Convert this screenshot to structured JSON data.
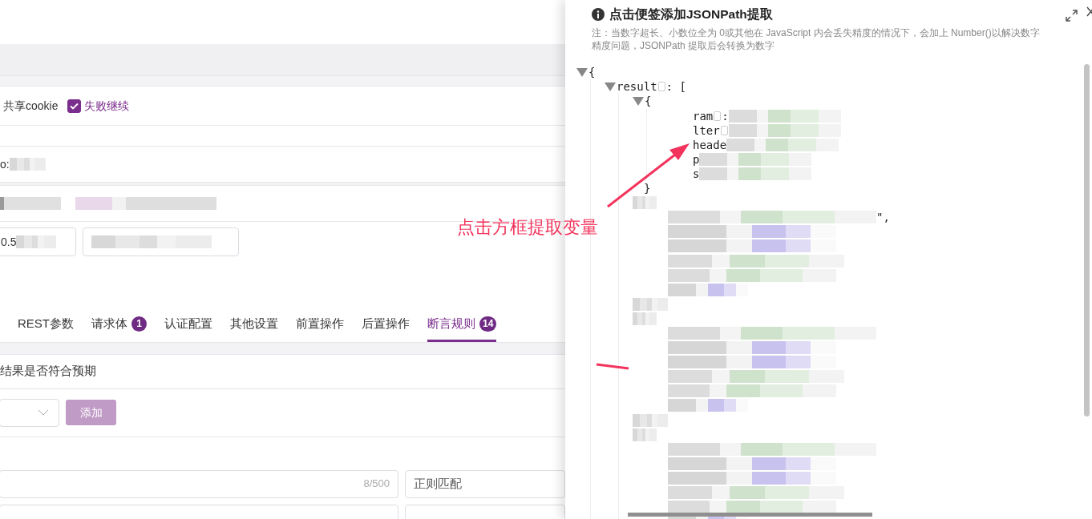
{
  "options": [
    {
      "label": "共享cookie",
      "kind": "text"
    },
    {
      "label": "失败继续",
      "kind": "checkbox",
      "checked": true
    }
  ],
  "host_label": "o:",
  "timeout_value": "0.5",
  "tabs": [
    {
      "label": "REST参数",
      "selected": false
    },
    {
      "label": "请求体",
      "badge": "1",
      "selected": false
    },
    {
      "label": "认证配置",
      "selected": false
    },
    {
      "label": "其他设置",
      "selected": false
    },
    {
      "label": "前置操作",
      "selected": false
    },
    {
      "label": "后置操作",
      "selected": false
    },
    {
      "label": "断言规则",
      "badge": "14",
      "selected": true
    }
  ],
  "assert_hint": "结果是否符合预期",
  "add_button": {
    "label": "添加",
    "disabled": true
  },
  "rules": [
    {
      "kind": "rule",
      "counter": "8/500",
      "match": "正则匹配"
    },
    {
      "kind": "empty_row"
    }
  ],
  "drawer": {
    "title": "点击便签添加JSONPath提取",
    "note_lines": [
      "注：当数字超长、小数位全为 0或其他在 JavaScript 内会丢失精度的情况下，会加上 Number()以解决数字",
      "精度问题，JSONPath 提取后会转换为数字"
    ],
    "json": {
      "kind": "node",
      "open": "{",
      "expanded": true,
      "children": [
        {
          "kind": "node",
          "key": "result",
          "open": ": [",
          "expanded": true,
          "children": [
            {
              "kind": "node",
              "open": "{",
              "expanded": true,
              "close": "}",
              "children": [
                {
                  "kind": "field",
                  "text": "ram",
                  "copy_box": true,
                  "after": ":"
                },
                {
                  "kind": "field",
                  "text": "lter",
                  "copy_box": true
                },
                {
                  "kind": "field",
                  "text": "heade"
                },
                {
                  "kind": "field",
                  "text": "p"
                },
                {
                  "kind": "field",
                  "text": "s"
                }
              ]
            },
            {
              "kind": "redacted_object",
              "after": "\","
            },
            {
              "kind": "redacted_object"
            },
            {
              "kind": "redacted_object"
            }
          ]
        }
      ]
    }
  },
  "annotation": {
    "text": "点击方框提取变量"
  }
}
